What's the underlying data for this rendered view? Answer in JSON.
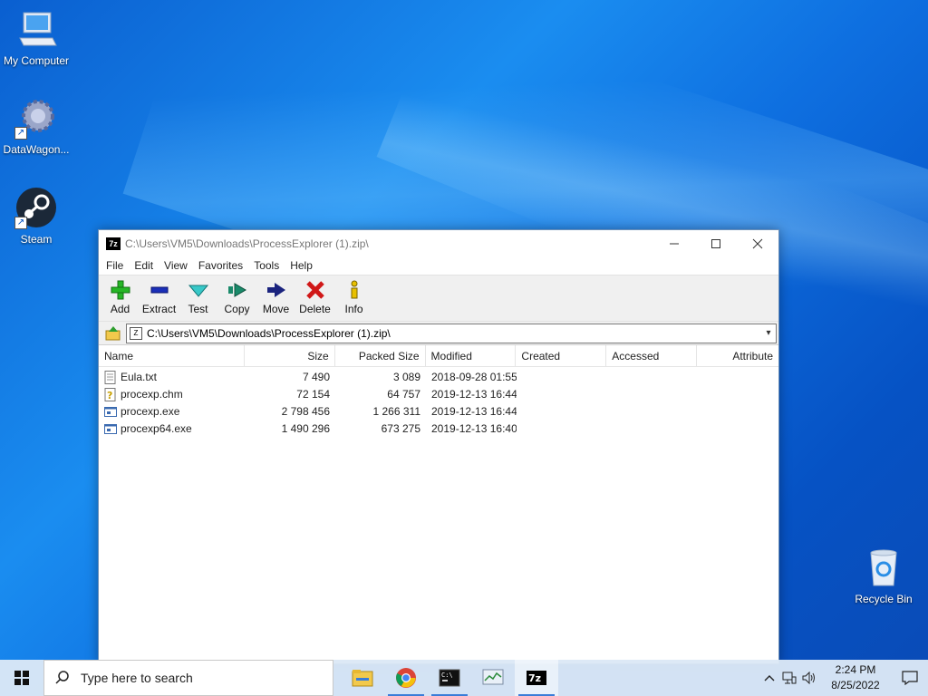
{
  "desktop": {
    "icons": [
      {
        "label": "My Computer"
      },
      {
        "label": "DataWagon..."
      },
      {
        "label": "Steam"
      },
      {
        "label": "Recycle Bin"
      }
    ]
  },
  "window": {
    "title": "C:\\Users\\VM5\\Downloads\\ProcessExplorer (1).zip\\",
    "app_icon": "7z",
    "menu": [
      "File",
      "Edit",
      "View",
      "Favorites",
      "Tools",
      "Help"
    ],
    "toolbar": [
      {
        "label": "Add",
        "icon": "plus-icon"
      },
      {
        "label": "Extract",
        "icon": "minus-icon"
      },
      {
        "label": "Test",
        "icon": "check-icon"
      },
      {
        "label": "Copy",
        "icon": "copy-arrow-icon"
      },
      {
        "label": "Move",
        "icon": "move-arrow-icon"
      },
      {
        "label": "Delete",
        "icon": "delete-x-icon"
      },
      {
        "label": "Info",
        "icon": "info-icon"
      }
    ],
    "address": "C:\\Users\\VM5\\Downloads\\ProcessExplorer (1).zip\\",
    "columns": [
      "Name",
      "Size",
      "Packed Size",
      "Modified",
      "Created",
      "Accessed",
      "Attribute"
    ],
    "files": [
      {
        "name": "Eula.txt",
        "size": "7 490",
        "packed": "3 089",
        "modified": "2018-09-28 01:55",
        "type": "txt"
      },
      {
        "name": "procexp.chm",
        "size": "72 154",
        "packed": "64 757",
        "modified": "2019-12-13 16:44",
        "type": "chm"
      },
      {
        "name": "procexp.exe",
        "size": "2 798 456",
        "packed": "1 266 311",
        "modified": "2019-12-13 16:44",
        "type": "exe"
      },
      {
        "name": "procexp64.exe",
        "size": "1 490 296",
        "packed": "673 275",
        "modified": "2019-12-13 16:40",
        "type": "exe"
      }
    ]
  },
  "taskbar": {
    "search_placeholder": "Type here to search",
    "time": "2:24 PM",
    "date": "8/25/2022",
    "apps": [
      "file-explorer",
      "chrome",
      "terminal",
      "task-manager",
      "7zip"
    ]
  },
  "colors": {
    "accent": "#0a64d8",
    "taskbar": "#dce8f6"
  }
}
